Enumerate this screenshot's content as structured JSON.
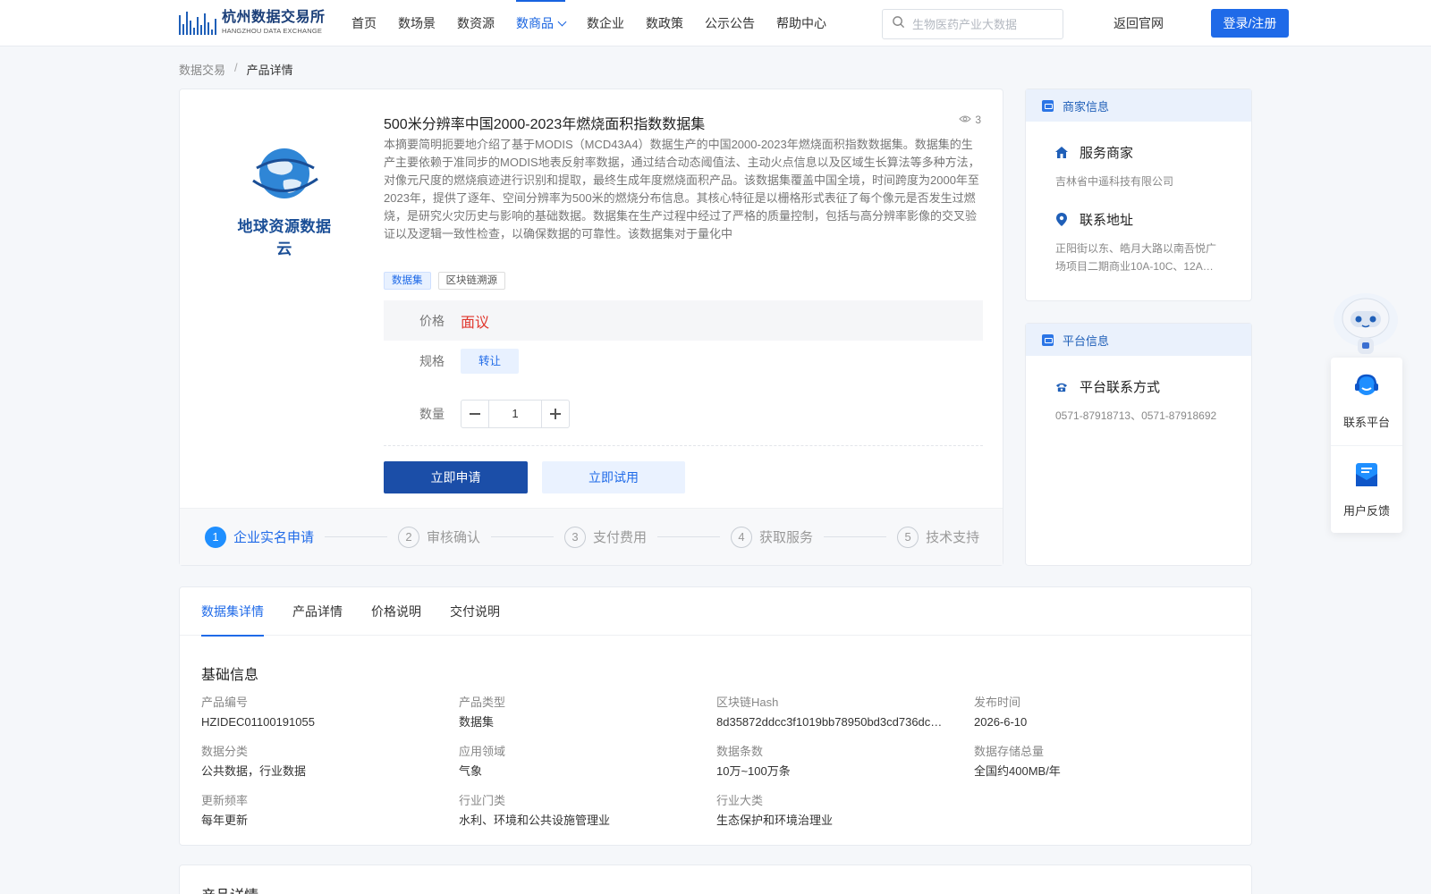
{
  "header": {
    "logo_cn": "杭州数据交易所",
    "logo_en": "HANGZHOU DATA EXCHANGE",
    "nav": [
      {
        "label": "首页"
      },
      {
        "label": "数场景"
      },
      {
        "label": "数资源"
      },
      {
        "label": "数商品",
        "active": true
      },
      {
        "label": "数企业"
      },
      {
        "label": "数政策"
      },
      {
        "label": "公示公告"
      },
      {
        "label": "帮助中心"
      }
    ],
    "search_placeholder": "生物医药产业大数据",
    "back_home": "返回官网",
    "login": "登录/注册",
    "accent": "#1763e0"
  },
  "breadcrumb": {
    "root": "数据交易",
    "sep": "/",
    "current": "产品详情"
  },
  "product": {
    "logo_text": "地球资源数据云",
    "title": "500米分辨率中国2000-2023年燃烧面积指数数据集",
    "views": "3",
    "description": "本摘要简明扼要地介绍了基于MODIS（MCD43A4）数据生产的中国2000-2023年燃烧面积指数数据集。数据集的生产主要依赖于准同步的MODIS地表反射率数据，通过结合动态阈值法、主动火点信息以及区域生长算法等多种方法，对像元尺度的燃烧痕迹进行识别和提取，最终生成年度燃烧面积产品。该数据集覆盖中国全境，时间跨度为2000年至2023年，提供了逐年、空间分辨率为500米的燃烧分布信息。其核心特征是以栅格形式表征了每个像元是否发生过燃烧，是研究火灾历史与影响的基础数据。数据集在生产过程中经过了严格的质量控制，包括与高分辨率影像的交叉验证以及逻辑一致性检查，以确保数据的可靠性。该数据集对于量化中",
    "tags": [
      "数据集",
      "区块链溯源"
    ],
    "price_label": "价格",
    "price_value": "面议",
    "spec_label": "规格",
    "spec_value": "转让",
    "qty_label": "数量",
    "qty_value": "1",
    "apply_btn": "立即申请",
    "trial_btn": "立即试用",
    "price_color": "#e0362c"
  },
  "steps": [
    {
      "num": "1",
      "label": "企业实名申请",
      "active": true
    },
    {
      "num": "2",
      "label": "审核确认"
    },
    {
      "num": "3",
      "label": "支付费用"
    },
    {
      "num": "4",
      "label": "获取服务"
    },
    {
      "num": "5",
      "label": "技术支持"
    }
  ],
  "merchant": {
    "head": "商家信息",
    "service_title": "服务商家",
    "service_value": "吉林省中遥科技有限公司",
    "address_title": "联系地址",
    "address_value": "正阳街以东、皓月大路以南吾悦广场项目二期商业10A-10C、12A…"
  },
  "platform": {
    "head": "平台信息",
    "contact_title": "平台联系方式",
    "contact_value": "0571-87918713、0571-87918692"
  },
  "floating": {
    "contact": "联系平台",
    "feedback": "用户反馈"
  },
  "details": {
    "tabs": [
      "数据集详情",
      "产品详情",
      "价格说明",
      "交付说明"
    ],
    "section_title": "基础信息",
    "fields": [
      {
        "k": "产品编号",
        "v": "HZIDEC01100191055"
      },
      {
        "k": "产品类型",
        "v": "数据集"
      },
      {
        "k": "区块链Hash",
        "v": "8d35872ddcc3f1019bb78950bd3cd736dc…"
      },
      {
        "k": "发布时间",
        "v": "2026-6-10"
      },
      {
        "k": "数据分类",
        "v": "公共数据，行业数据"
      },
      {
        "k": "应用领域",
        "v": "气象"
      },
      {
        "k": "数据条数",
        "v": "10万~100万条"
      },
      {
        "k": "数据存储总量",
        "v": "全国约400MB/年"
      },
      {
        "k": "更新频率",
        "v": "每年更新"
      },
      {
        "k": "行业门类",
        "v": "水利、环境和公共设施管理业"
      },
      {
        "k": "行业大类",
        "v": "生态保护和环境治理业"
      }
    ],
    "next_section": "产品详情"
  }
}
